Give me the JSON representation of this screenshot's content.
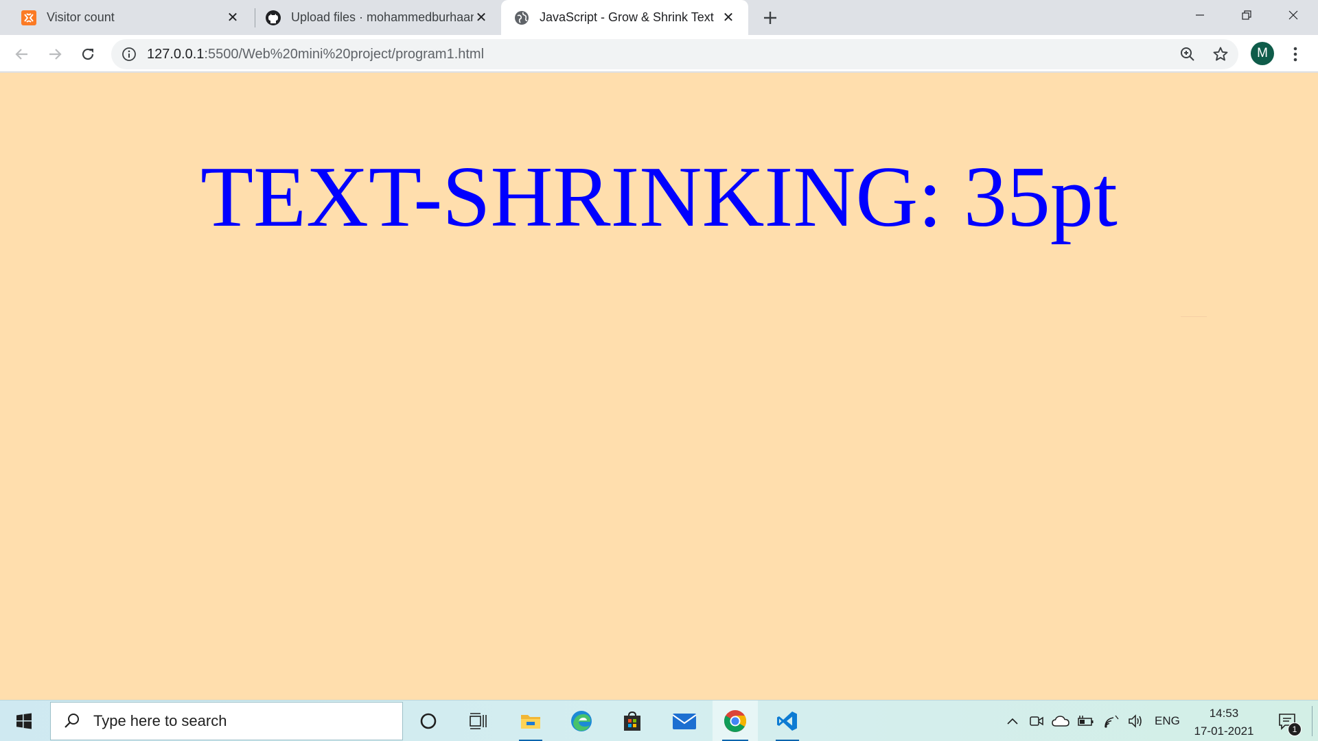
{
  "browser": {
    "tabs": [
      {
        "title": "Visitor count",
        "icon": "xampp-icon",
        "active": false
      },
      {
        "title": "Upload files · mohammedburhaan",
        "icon": "github-icon",
        "active": false
      },
      {
        "title": "JavaScript - Grow & Shrink Text",
        "icon": "globe-icon",
        "active": true
      }
    ],
    "new_tab_icon": "plus-icon",
    "address": {
      "host": "127.0.0.1",
      "path": ":5500/Web%20mini%20project/program1.html"
    },
    "profile_initial": "M"
  },
  "page": {
    "heading": "TEXT-SHRINKING: 35pt",
    "background_color": "#ffdead",
    "text_color": "#0000ff"
  },
  "taskbar": {
    "search_placeholder": "Type here to search",
    "language": "ENG",
    "time": "14:53",
    "date": "17-01-2021",
    "notification_count": "1",
    "apps": [
      "cortana-icon",
      "task-view-icon",
      "file-explorer-icon",
      "edge-icon",
      "store-icon",
      "mail-icon",
      "chrome-icon",
      "vscode-icon"
    ]
  }
}
